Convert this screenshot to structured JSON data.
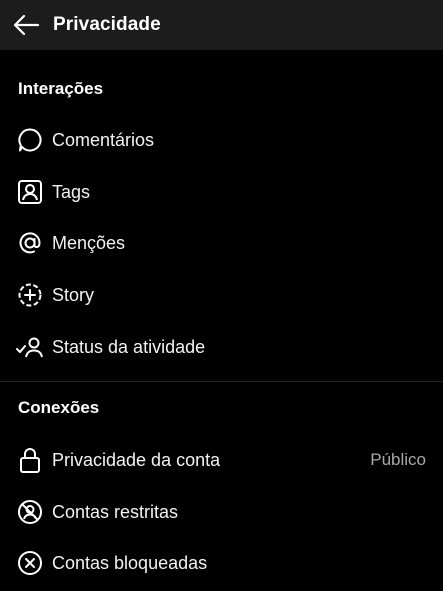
{
  "header": {
    "title": "Privacidade",
    "back_icon": "arrow-left-icon"
  },
  "sections": [
    {
      "title": "Interações",
      "items": [
        {
          "label": "Comentários",
          "icon": "comment-bubble-icon"
        },
        {
          "label": "Tags",
          "icon": "tag-person-icon"
        },
        {
          "label": "Menções",
          "icon": "at-sign-icon"
        },
        {
          "label": "Story",
          "icon": "story-plus-icon"
        },
        {
          "label": "Status da atividade",
          "icon": "activity-status-icon"
        }
      ]
    },
    {
      "title": "Conexões",
      "items": [
        {
          "label": "Privacidade da conta",
          "value": "Público",
          "icon": "lock-icon"
        },
        {
          "label": "Contas restritas",
          "icon": "restricted-icon"
        },
        {
          "label": "Contas bloqueadas",
          "icon": "blocked-icon"
        }
      ]
    }
  ],
  "colors": {
    "background": "#000000",
    "header_background": "#1c1c1c",
    "text": "#f2f2f2",
    "secondary_text": "#a8a8a8",
    "divider": "#262626"
  }
}
